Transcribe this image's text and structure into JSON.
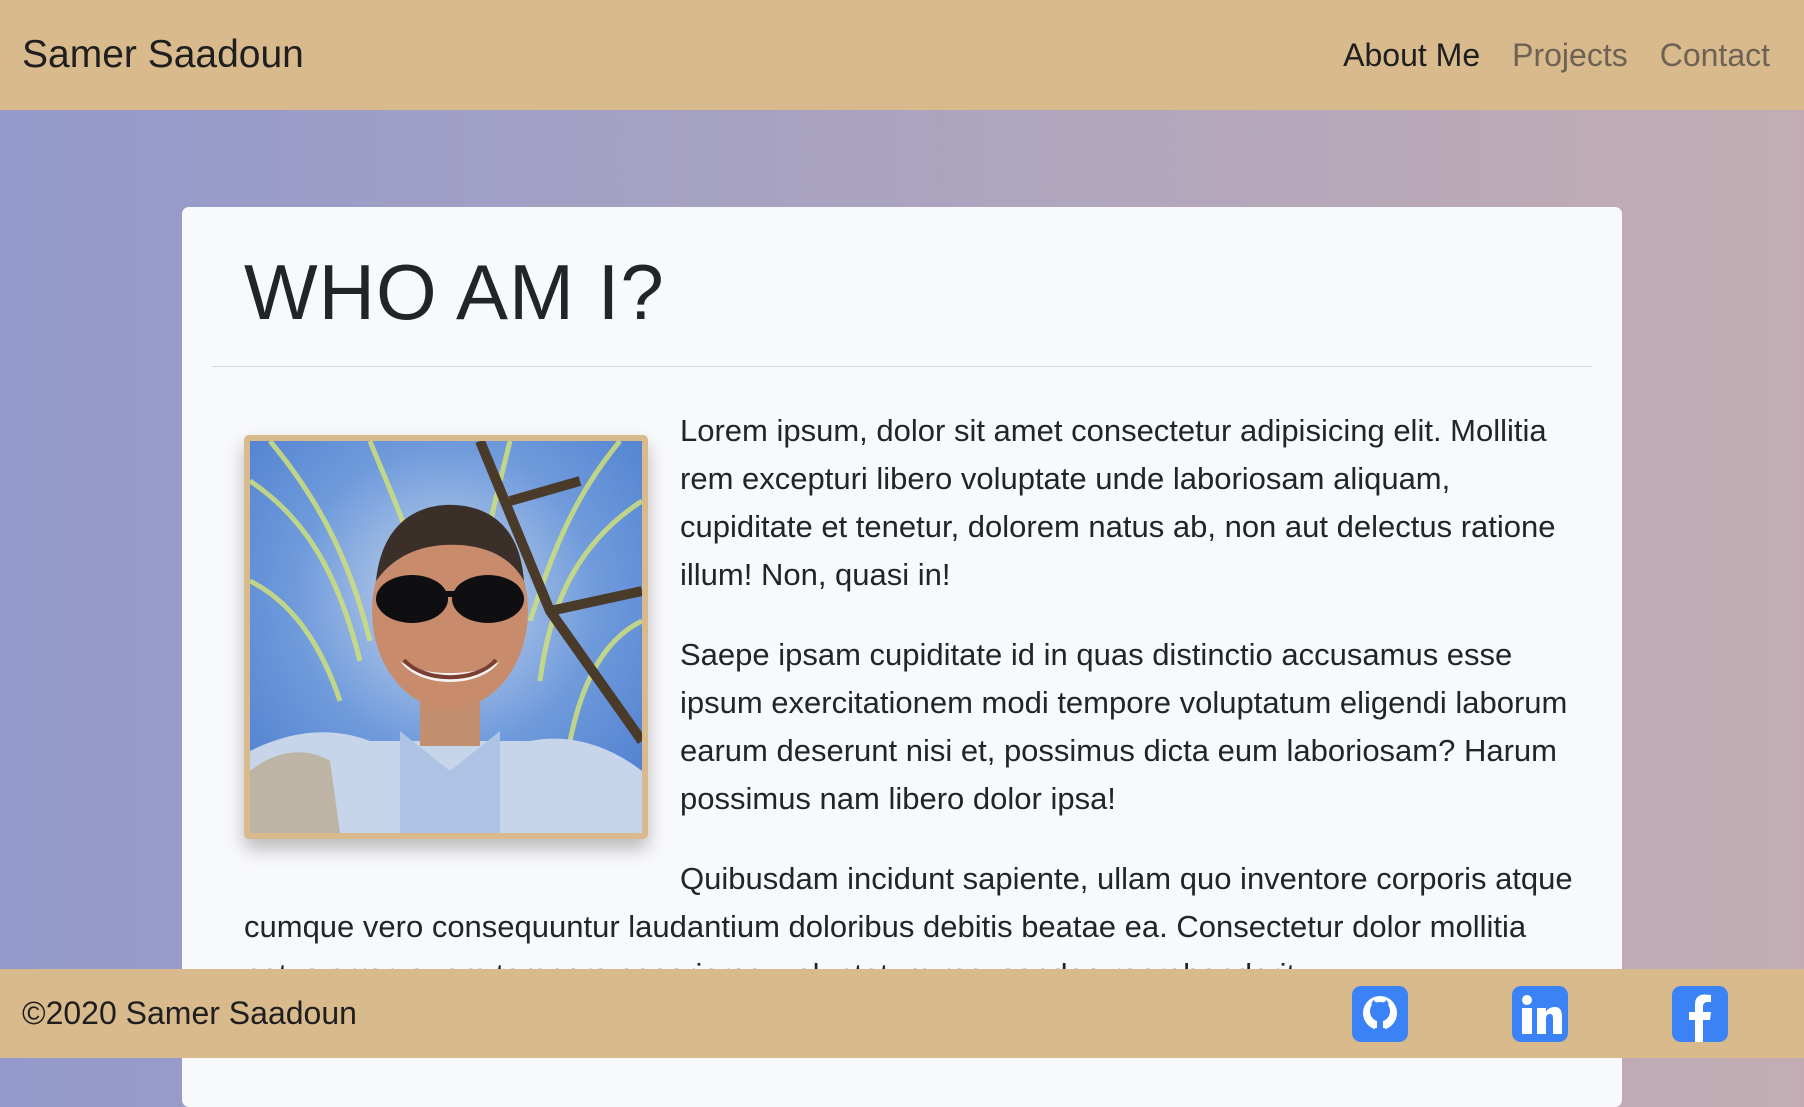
{
  "navbar": {
    "brand": "Samer Saadoun",
    "links": [
      "About Me",
      "Projects",
      "Contact"
    ]
  },
  "main": {
    "title": "WHO AM I?",
    "paragraphs": [
      "Lorem ipsum, dolor sit amet consectetur adipisicing elit. Mollitia rem excepturi libero voluptate unde laboriosam aliquam, cupiditate et tenetur, dolorem natus ab, non aut delectus ratione illum! Non, quasi in!",
      "Saepe ipsam cupiditate id in quas distinctio accusamus esse ipsum exercitationem modi tempore voluptatum eligendi laborum earum deserunt nisi et, possimus dicta eum laboriosam? Harum possimus nam libero dolor ipsa!",
      "Quibusdam incidunt sapiente, ullam quo inventore corporis atque cumque vero consequuntur laudantium doloribus debitis beatae ea. Consectetur dolor mollitia natus error, quam tempore asperiores, voluptatum recusandae reprehenderit."
    ]
  },
  "footer": {
    "copyright": "©2020 Samer Saadoun",
    "social_icons": [
      "github-icon",
      "linkedin-icon",
      "facebook-icon"
    ]
  },
  "colors": {
    "nav_bg": "#d8ba8c",
    "social_blue": "#3b82f6",
    "card_bg": "#f8f9fb"
  }
}
